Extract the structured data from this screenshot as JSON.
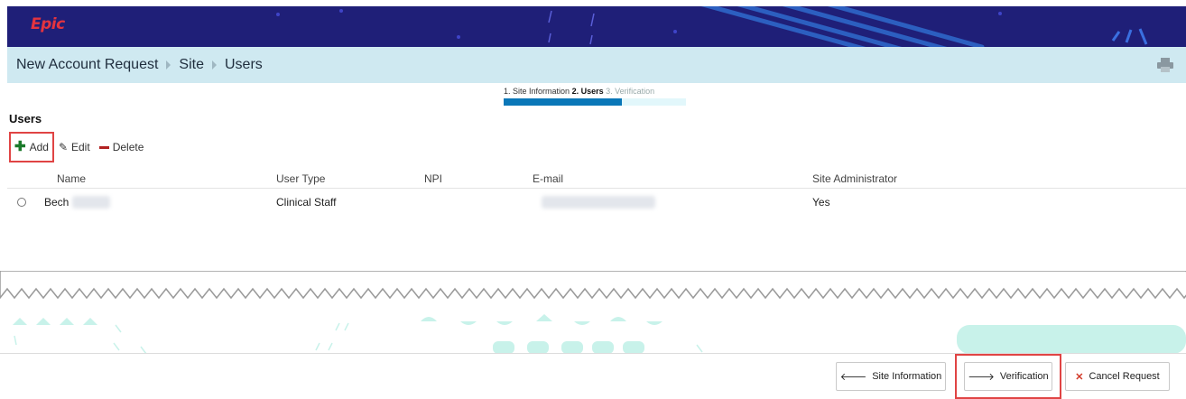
{
  "header": {
    "logo_text": "Epic"
  },
  "breadcrumb": {
    "items": [
      "New Account Request",
      "Site",
      "Users"
    ]
  },
  "steps": {
    "step1": "1. Site Information",
    "step2": "2. Users",
    "step3": "3. Verification",
    "progress_fraction": 0.65
  },
  "section": {
    "title": "Users"
  },
  "toolbar": {
    "add_label": "Add",
    "edit_label": "Edit",
    "delete_label": "Delete"
  },
  "table": {
    "headers": {
      "name": "Name",
      "user_type": "User Type",
      "npi": "NPI",
      "email": "E-mail",
      "site_admin": "Site Administrator"
    },
    "rows": [
      {
        "name": "Bech",
        "user_type": "Clinical Staff",
        "npi": "",
        "site_admin": "Yes"
      }
    ]
  },
  "footer": {
    "back_label": "Site Information",
    "next_label": "Verification",
    "cancel_label": "Cancel Request"
  },
  "colors": {
    "header_bg": "#1f1f78",
    "breadcrumb_bg": "#cfe9f1",
    "progress_fill": "#0a77b8",
    "highlight": "#e04444"
  }
}
